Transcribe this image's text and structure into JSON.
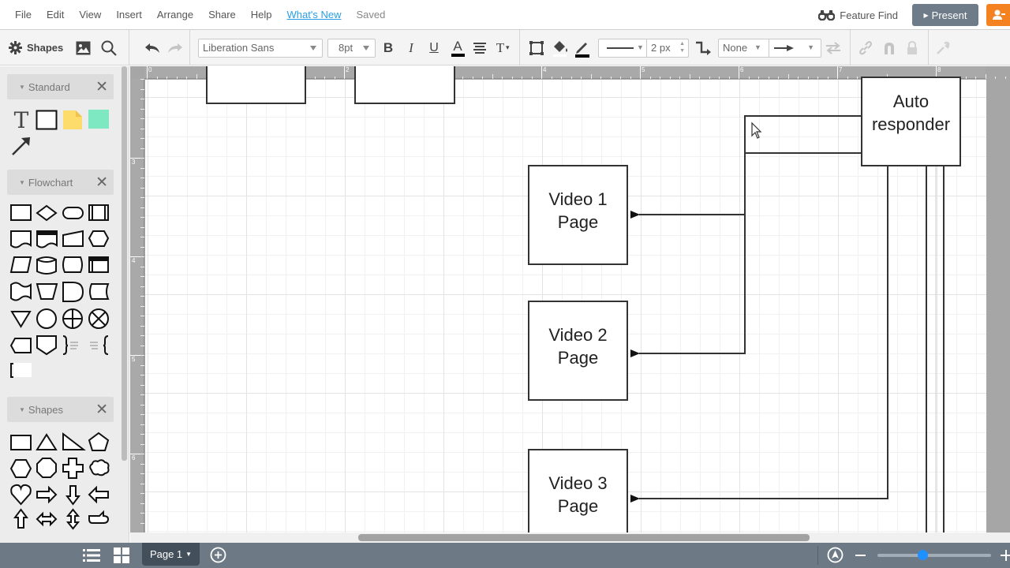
{
  "menubar": {
    "items": [
      {
        "label": "File"
      },
      {
        "label": "Edit"
      },
      {
        "label": "View"
      },
      {
        "label": "Insert"
      },
      {
        "label": "Arrange"
      },
      {
        "label": "Share"
      },
      {
        "label": "Help"
      }
    ],
    "whats_new": "What's New",
    "status": "Saved",
    "feature_find": "Feature Find",
    "present": "Present"
  },
  "toolbar": {
    "shapes_label": "Shapes",
    "font_family": "Liberation Sans",
    "font_size": "8pt",
    "line_width": "2 px",
    "line_start": "None",
    "bold": "B",
    "italic": "I",
    "underline": "U",
    "font_color_label": "A",
    "text_options": "T"
  },
  "sidebar": {
    "panels": [
      {
        "title": "Standard",
        "shapes": [
          "text",
          "rectangle",
          "note",
          "colored-rectangle",
          "arrow"
        ]
      },
      {
        "title": "Flowchart",
        "shapes": [
          "process",
          "decision",
          "terminator",
          "predefined-process",
          "document",
          "multi-document",
          "manual-input",
          "preparation",
          "data",
          "database",
          "direct-access-storage",
          "internal-storage",
          "paper-tape",
          "manual-operation",
          "delay",
          "stored-data",
          "merge",
          "connector",
          "or",
          "summing-junction",
          "display",
          "off-page-connector",
          "annotation-left",
          "annotation-right",
          "annotation-bracket"
        ]
      },
      {
        "title": "Shapes",
        "shapes": [
          "rectangle",
          "triangle",
          "right-triangle",
          "pentagon",
          "hexagon",
          "octagon",
          "cross",
          "cloud",
          "heart",
          "arrow-right",
          "arrow-down",
          "arrow-left",
          "arrow-up",
          "arrow-left-right",
          "arrow-up-down",
          "callout"
        ]
      }
    ]
  },
  "ruler": {
    "top_labels": [
      "0",
      "1",
      "2",
      "3",
      "4",
      "5",
      "6",
      "7",
      "8"
    ],
    "left_labels": [
      "3",
      "4",
      "5",
      "6"
    ]
  },
  "diagram": {
    "nodes": [
      {
        "id": "video1",
        "label_line1": "Video 1",
        "label_line2": "Page"
      },
      {
        "id": "video2",
        "label_line1": "Video 2",
        "label_line2": "Page"
      },
      {
        "id": "video3",
        "label_line1": "Video 3",
        "label_line2": "Page"
      },
      {
        "id": "autoresponder",
        "label_line1": "Auto",
        "label_line2": "responder"
      }
    ]
  },
  "bottombar": {
    "page_tab": "Page 1",
    "zoom_level": 0.4
  },
  "colors": {
    "accent_blue": "#2a9fe6",
    "present_button": "#6e7c89",
    "share_button": "#f58220",
    "bottom_bar": "#6d7a86",
    "zoom_knob": "#1e90ff",
    "note_yellow": "#fddc6c",
    "colored_shape": "#7ee8c2"
  }
}
